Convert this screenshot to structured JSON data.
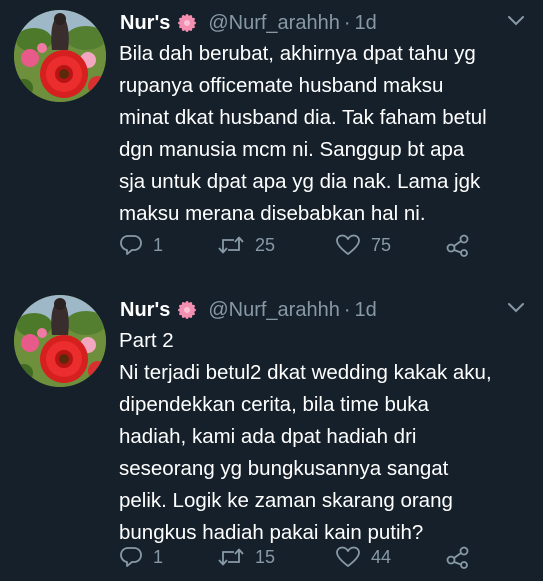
{
  "tweets": [
    {
      "author_name": "Nur's",
      "handle": "@Nurf_arahhh",
      "separator": "·",
      "time": "1d",
      "lines": [
        "Bila dah berubat, akhirnya dpat tahu yg",
        "rupanya officemate husband maksu",
        "minat dkat husband dia. Tak faham betul",
        "dgn manusia mcm ni. Sanggup bt apa",
        "sja untuk dpat apa yg dia nak. Lama jgk",
        "maksu merana disebabkan hal ni."
      ],
      "replies": "1",
      "retweets": "25",
      "likes": "75"
    },
    {
      "author_name": "Nur's",
      "handle": "@Nurf_arahhh",
      "separator": "·",
      "time": "1d",
      "lines": [
        "Part 2",
        "Ni terjadi betul2 dkat wedding kakak aku,",
        "dipendekkan cerita, bila time buka",
        "hadiah, kami ada dpat hadiah dri",
        "seseorang yg bungkusannya sangat",
        "pelik. Logik ke zaman skarang orang",
        "bungkus hadiah pakai kain putih?"
      ],
      "replies": "1",
      "retweets": "15",
      "likes": "44"
    }
  ],
  "icons": {
    "badge": "pink-flower-icon",
    "reply": "reply-icon",
    "retweet": "retweet-icon",
    "like": "heart-icon",
    "share": "share-icon",
    "menu": "chevron-down-icon"
  },
  "colors": {
    "background": "#15202b",
    "text": "#ffffff",
    "muted": "#8899a6",
    "badge": "#f48fb1"
  }
}
